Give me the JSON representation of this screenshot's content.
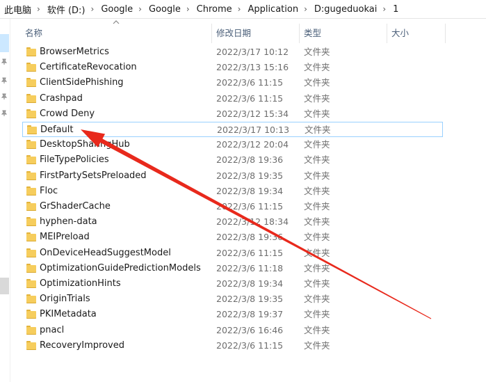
{
  "breadcrumb": [
    "此电脑",
    "软件 (D:)",
    "Google",
    "Google",
    "Chrome",
    "Application",
    "D:gugeduokai",
    "1"
  ],
  "breadcrumb_separator": "›",
  "columns": {
    "name": "名称",
    "date": "修改日期",
    "type": "类型",
    "size": "大小"
  },
  "selected_index": 5,
  "files": [
    {
      "name": "BrowserMetrics",
      "date": "2022/3/17 10:12",
      "type": "文件夹"
    },
    {
      "name": "CertificateRevocation",
      "date": "2022/3/13 15:16",
      "type": "文件夹"
    },
    {
      "name": "ClientSidePhishing",
      "date": "2022/3/6 11:15",
      "type": "文件夹"
    },
    {
      "name": "Crashpad",
      "date": "2022/3/6 11:15",
      "type": "文件夹"
    },
    {
      "name": "Crowd Deny",
      "date": "2022/3/12 15:34",
      "type": "文件夹"
    },
    {
      "name": "Default",
      "date": "2022/3/17 10:13",
      "type": "文件夹"
    },
    {
      "name": "DesktopSharingHub",
      "date": "2022/3/12 20:04",
      "type": "文件夹"
    },
    {
      "name": "FileTypePolicies",
      "date": "2022/3/8 19:36",
      "type": "文件夹"
    },
    {
      "name": "FirstPartySetsPreloaded",
      "date": "2022/3/8 19:35",
      "type": "文件夹"
    },
    {
      "name": "Floc",
      "date": "2022/3/8 19:34",
      "type": "文件夹"
    },
    {
      "name": "GrShaderCache",
      "date": "2022/3/6 11:15",
      "type": "文件夹"
    },
    {
      "name": "hyphen-data",
      "date": "2022/3/12 18:34",
      "type": "文件夹"
    },
    {
      "name": "MEIPreload",
      "date": "2022/3/8 19:36",
      "type": "文件夹"
    },
    {
      "name": "OnDeviceHeadSuggestModel",
      "date": "2022/3/6 11:15",
      "type": "文件夹"
    },
    {
      "name": "OptimizationGuidePredictionModels",
      "date": "2022/3/6 11:18",
      "type": "文件夹"
    },
    {
      "name": "OptimizationHints",
      "date": "2022/3/8 19:34",
      "type": "文件夹"
    },
    {
      "name": "OriginTrials",
      "date": "2022/3/8 19:35",
      "type": "文件夹"
    },
    {
      "name": "PKIMetadata",
      "date": "2022/3/8 19:37",
      "type": "文件夹"
    },
    {
      "name": "pnacl",
      "date": "2022/3/6 16:46",
      "type": "文件夹"
    },
    {
      "name": "RecoveryImproved",
      "date": "2022/3/6 11:15",
      "type": "文件夹"
    }
  ],
  "colors": {
    "annotation_arrow": "#e8291c",
    "folder": "#f6cd5d",
    "selection_border": "#99d1ff"
  },
  "icons": [
    "folder-icon",
    "pin-icon",
    "sort-up-icon"
  ]
}
